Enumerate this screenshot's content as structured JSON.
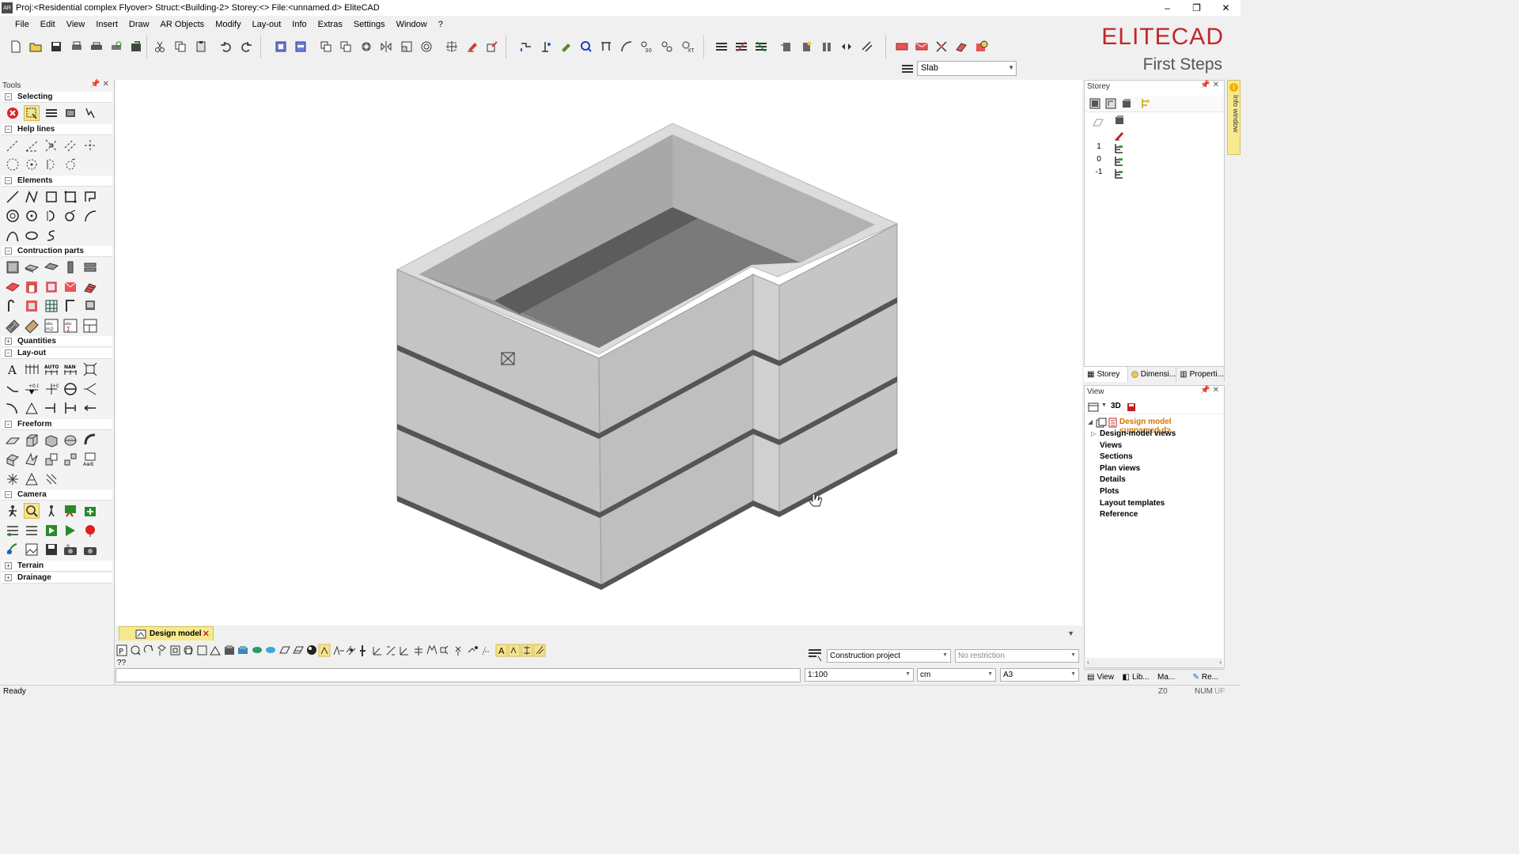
{
  "window": {
    "app_icon_text": "AR",
    "title": "Proj:<Residential complex Flyover> Struct:<Building-2> Storey:<> File:<unnamed.d> EliteCAD",
    "buttons": [
      "–",
      "❐",
      "✕"
    ]
  },
  "menu": [
    "File",
    "Edit",
    "View",
    "Insert",
    "Draw",
    "AR Objects",
    "Modify",
    "Lay-out",
    "Info",
    "Extras",
    "Settings",
    "Window",
    "?"
  ],
  "layer_select": {
    "value": "Slab"
  },
  "brand": {
    "logo": "ELITECAD",
    "subtitle": "First Steps"
  },
  "tools": {
    "title": "Tools",
    "sections": [
      {
        "label": "Selecting",
        "expanded": true
      },
      {
        "label": "Help lines",
        "expanded": true
      },
      {
        "label": "Elements",
        "expanded": true
      },
      {
        "label": "Contruction parts",
        "expanded": true
      },
      {
        "label": "Quantities",
        "expanded": false
      },
      {
        "label": "Lay-out",
        "expanded": true
      },
      {
        "label": "Freeform",
        "expanded": true
      },
      {
        "label": "Camera",
        "expanded": true
      },
      {
        "label": "Terrain",
        "expanded": false
      },
      {
        "label": "Drainage",
        "expanded": false
      }
    ]
  },
  "document_tab": {
    "label": "Design model",
    "close": "✕"
  },
  "command": {
    "prompt": "??"
  },
  "status_fields": {
    "project": "Construction project",
    "restriction": "No restriction",
    "scale": "1:100",
    "unit": "cm",
    "paper": "A3"
  },
  "status": {
    "ready": "Ready",
    "z": "Z0",
    "num": "NUM",
    "uf": "UF"
  },
  "storey": {
    "title": "Storey",
    "rows": [
      "1",
      "0",
      "-1"
    ],
    "tabs": [
      "Storey",
      "Dimensi...",
      "Properti..."
    ]
  },
  "info_window": {
    "label": "Info window"
  },
  "view": {
    "title": "View",
    "mode": "3D",
    "root": "Design model <unnamed.d>",
    "items": [
      "Design-model views",
      "Views",
      "Sections",
      "Plan views",
      "Details",
      "Plots",
      "Layout templates",
      "Reference"
    ],
    "tabs": [
      "View",
      "Lib...",
      "Ma...",
      "Re..."
    ]
  },
  "colors": {
    "accent_yellow": "#f7e98f",
    "brand_red": "#c0282b",
    "tree_orange": "#d07400"
  }
}
